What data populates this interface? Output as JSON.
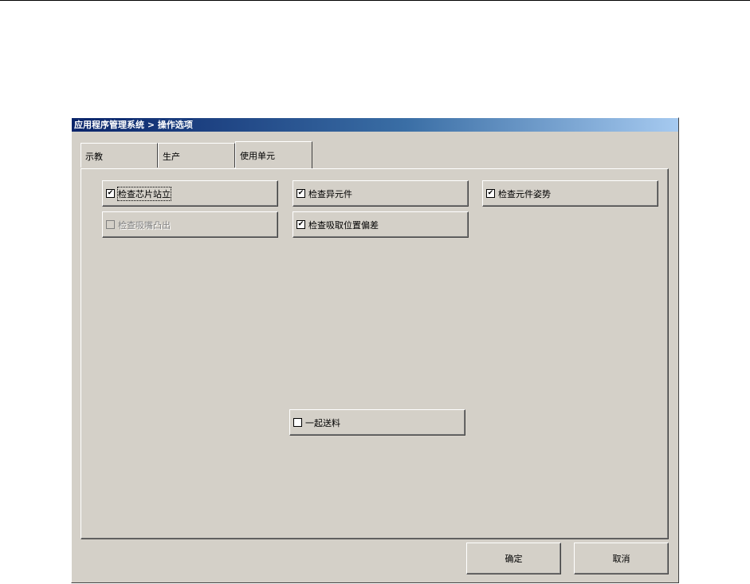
{
  "window": {
    "title": "应用程序管理系统 > 操作选项"
  },
  "tabs": [
    {
      "label": "示教",
      "active": false
    },
    {
      "label": "生产",
      "active": false
    },
    {
      "label": "使用单元",
      "active": true
    }
  ],
  "options": {
    "check_chip_stand": {
      "label": "检查芯片站立",
      "checked": true,
      "enabled": true
    },
    "check_odd_component": {
      "label": "检查异元件",
      "checked": true,
      "enabled": true
    },
    "check_component_pose": {
      "label": "检查元件姿势",
      "checked": true,
      "enabled": true
    },
    "check_nozzle_protrude": {
      "label": "检查吸嘴凸出",
      "checked": false,
      "enabled": false
    },
    "check_pick_offset": {
      "label": "检查吸取位置偏差",
      "checked": true,
      "enabled": true
    },
    "feed_together": {
      "label": "一起送料",
      "checked": false,
      "enabled": true
    }
  },
  "buttons": {
    "ok": "确定",
    "cancel": "取消"
  }
}
